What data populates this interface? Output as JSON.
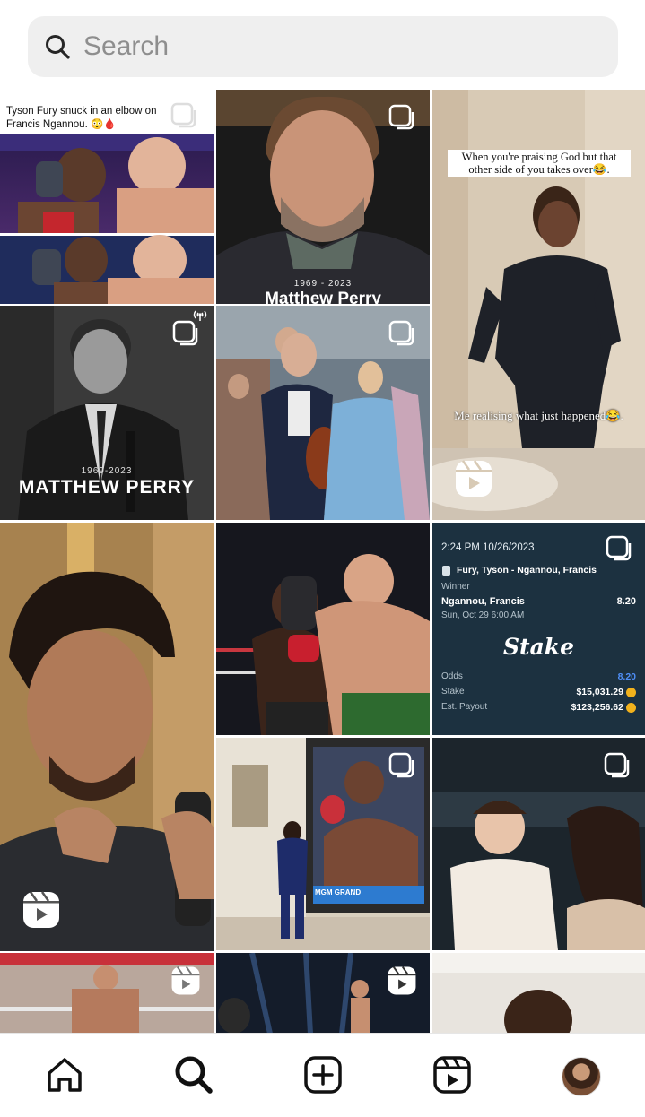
{
  "search": {
    "placeholder": "Search",
    "icon": "search-icon"
  },
  "tiles": {
    "fury_tweet": {
      "caption": "Tyson Fury snuck in an elbow on Francis Ngannou. 😳🩸"
    },
    "perry_color": {
      "years": "1969 - 2023",
      "name": "Matthew Perry"
    },
    "praising": {
      "top_caption": "When you're praising God but that other side of you takes over😂.",
      "bottom_caption": "Me realising what just happened😂."
    },
    "perry_bw": {
      "years": "1969-2023",
      "name": "MATTHEW PERRY"
    },
    "stake": {
      "timestamp": "2:24 PM 10/26/2023",
      "match": "Fury, Tyson - Ngannou, Francis",
      "market": "Winner",
      "pick": "Ngannou, Francis",
      "pick_odds": "8.20",
      "event_time": "Sun, Oct 29 6:00 AM",
      "brand": "Stake",
      "odds_label": "Odds",
      "odds_value": "8.20",
      "stake_label": "Stake",
      "stake_value": "$15,031.29",
      "payout_label": "Est. Payout",
      "payout_value": "$123,256.62"
    },
    "boxing_art": {
      "banner": "MGM GRAND"
    }
  },
  "nav": {
    "items": [
      "home-icon",
      "search-icon",
      "create-icon",
      "reels-icon",
      "profile-avatar"
    ],
    "active": "search-icon"
  },
  "colors": {
    "stake_bg": "#1f3646",
    "odds_blue": "#4f8ff7",
    "coin": "#f2b21c"
  }
}
